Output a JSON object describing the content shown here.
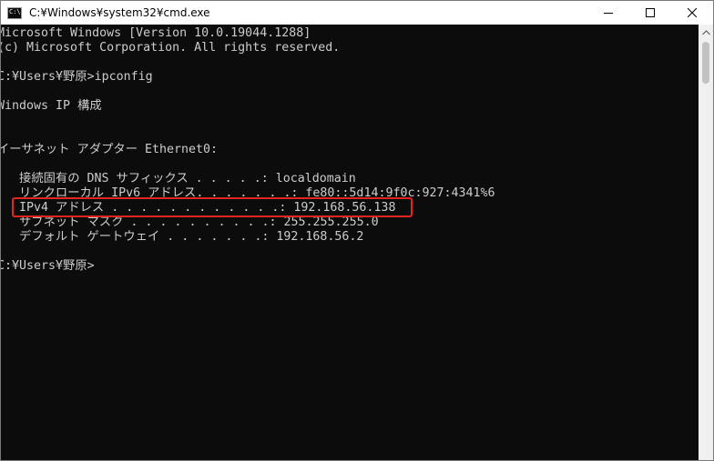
{
  "window": {
    "title": "C:¥Windows¥system32¥cmd.exe",
    "icon_text": "C:\\."
  },
  "console_lines": [
    "Microsoft Windows [Version 10.0.19044.1288]",
    "(c) Microsoft Corporation. All rights reserved.",
    "",
    "C:¥Users¥野原>ipconfig",
    "",
    "Windows IP 構成",
    "",
    "",
    "イーサネット アダプター Ethernet0:",
    "",
    "   接続固有の DNS サフィックス . . . . .: localdomain",
    "   リンクローカル IPv6 アドレス. . . . . . .: fe80::5d14:9f0c:927:4341%6",
    "   IPv4 アドレス . . . . . . . . . . . .: 192.168.56.138",
    "   サブネット マスク . . . . . . . . . .: 255.255.255.0",
    "   デフォルト ゲートウェイ . . . . . . .: 192.168.56.2",
    "",
    "C:¥Users¥野原>"
  ],
  "colors": {
    "console_bg": "#0c0c0c",
    "console_text": "#cccccc",
    "highlight": "#e52420"
  },
  "icons": {
    "minimize": "minimize-icon",
    "maximize": "maximize-icon",
    "close": "close-icon",
    "scroll_up": "chevron-up-icon"
  }
}
